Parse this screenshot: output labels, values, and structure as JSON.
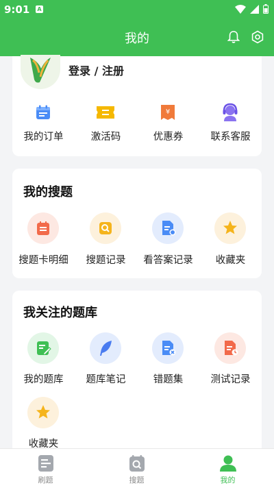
{
  "status": {
    "time": "9:01"
  },
  "header": {
    "title": "我的"
  },
  "account": {
    "login_label": "登录 / 注册"
  },
  "quick_actions": [
    {
      "label": "我的订单",
      "icon": "calendar-icon"
    },
    {
      "label": "激活码",
      "icon": "ticket-icon"
    },
    {
      "label": "优惠券",
      "icon": "coupon-icon"
    },
    {
      "label": "联系客服",
      "icon": "headset-icon"
    }
  ],
  "search_section": {
    "title": "我的搜题",
    "items": [
      {
        "label": "搜题卡明细",
        "icon": "card-detail-icon"
      },
      {
        "label": "搜题记录",
        "icon": "search-record-icon"
      },
      {
        "label": "看答案记录",
        "icon": "answer-record-icon"
      },
      {
        "label": "收藏夹",
        "icon": "star-icon"
      }
    ]
  },
  "bank_section": {
    "title": "我关注的题库",
    "items": [
      {
        "label": "我的题库",
        "icon": "my-bank-icon"
      },
      {
        "label": "题库笔记",
        "icon": "feather-icon"
      },
      {
        "label": "错题集",
        "icon": "wrong-set-icon"
      },
      {
        "label": "测试记录",
        "icon": "test-record-icon"
      },
      {
        "label": "收藏夹",
        "icon": "star-icon"
      }
    ]
  },
  "bottom_nav": [
    {
      "label": "刷题",
      "active": false
    },
    {
      "label": "搜题",
      "active": false
    },
    {
      "label": "我的",
      "active": true
    }
  ],
  "colors": {
    "brand_green": "#3fbf54",
    "background": "#f3f4f6"
  }
}
